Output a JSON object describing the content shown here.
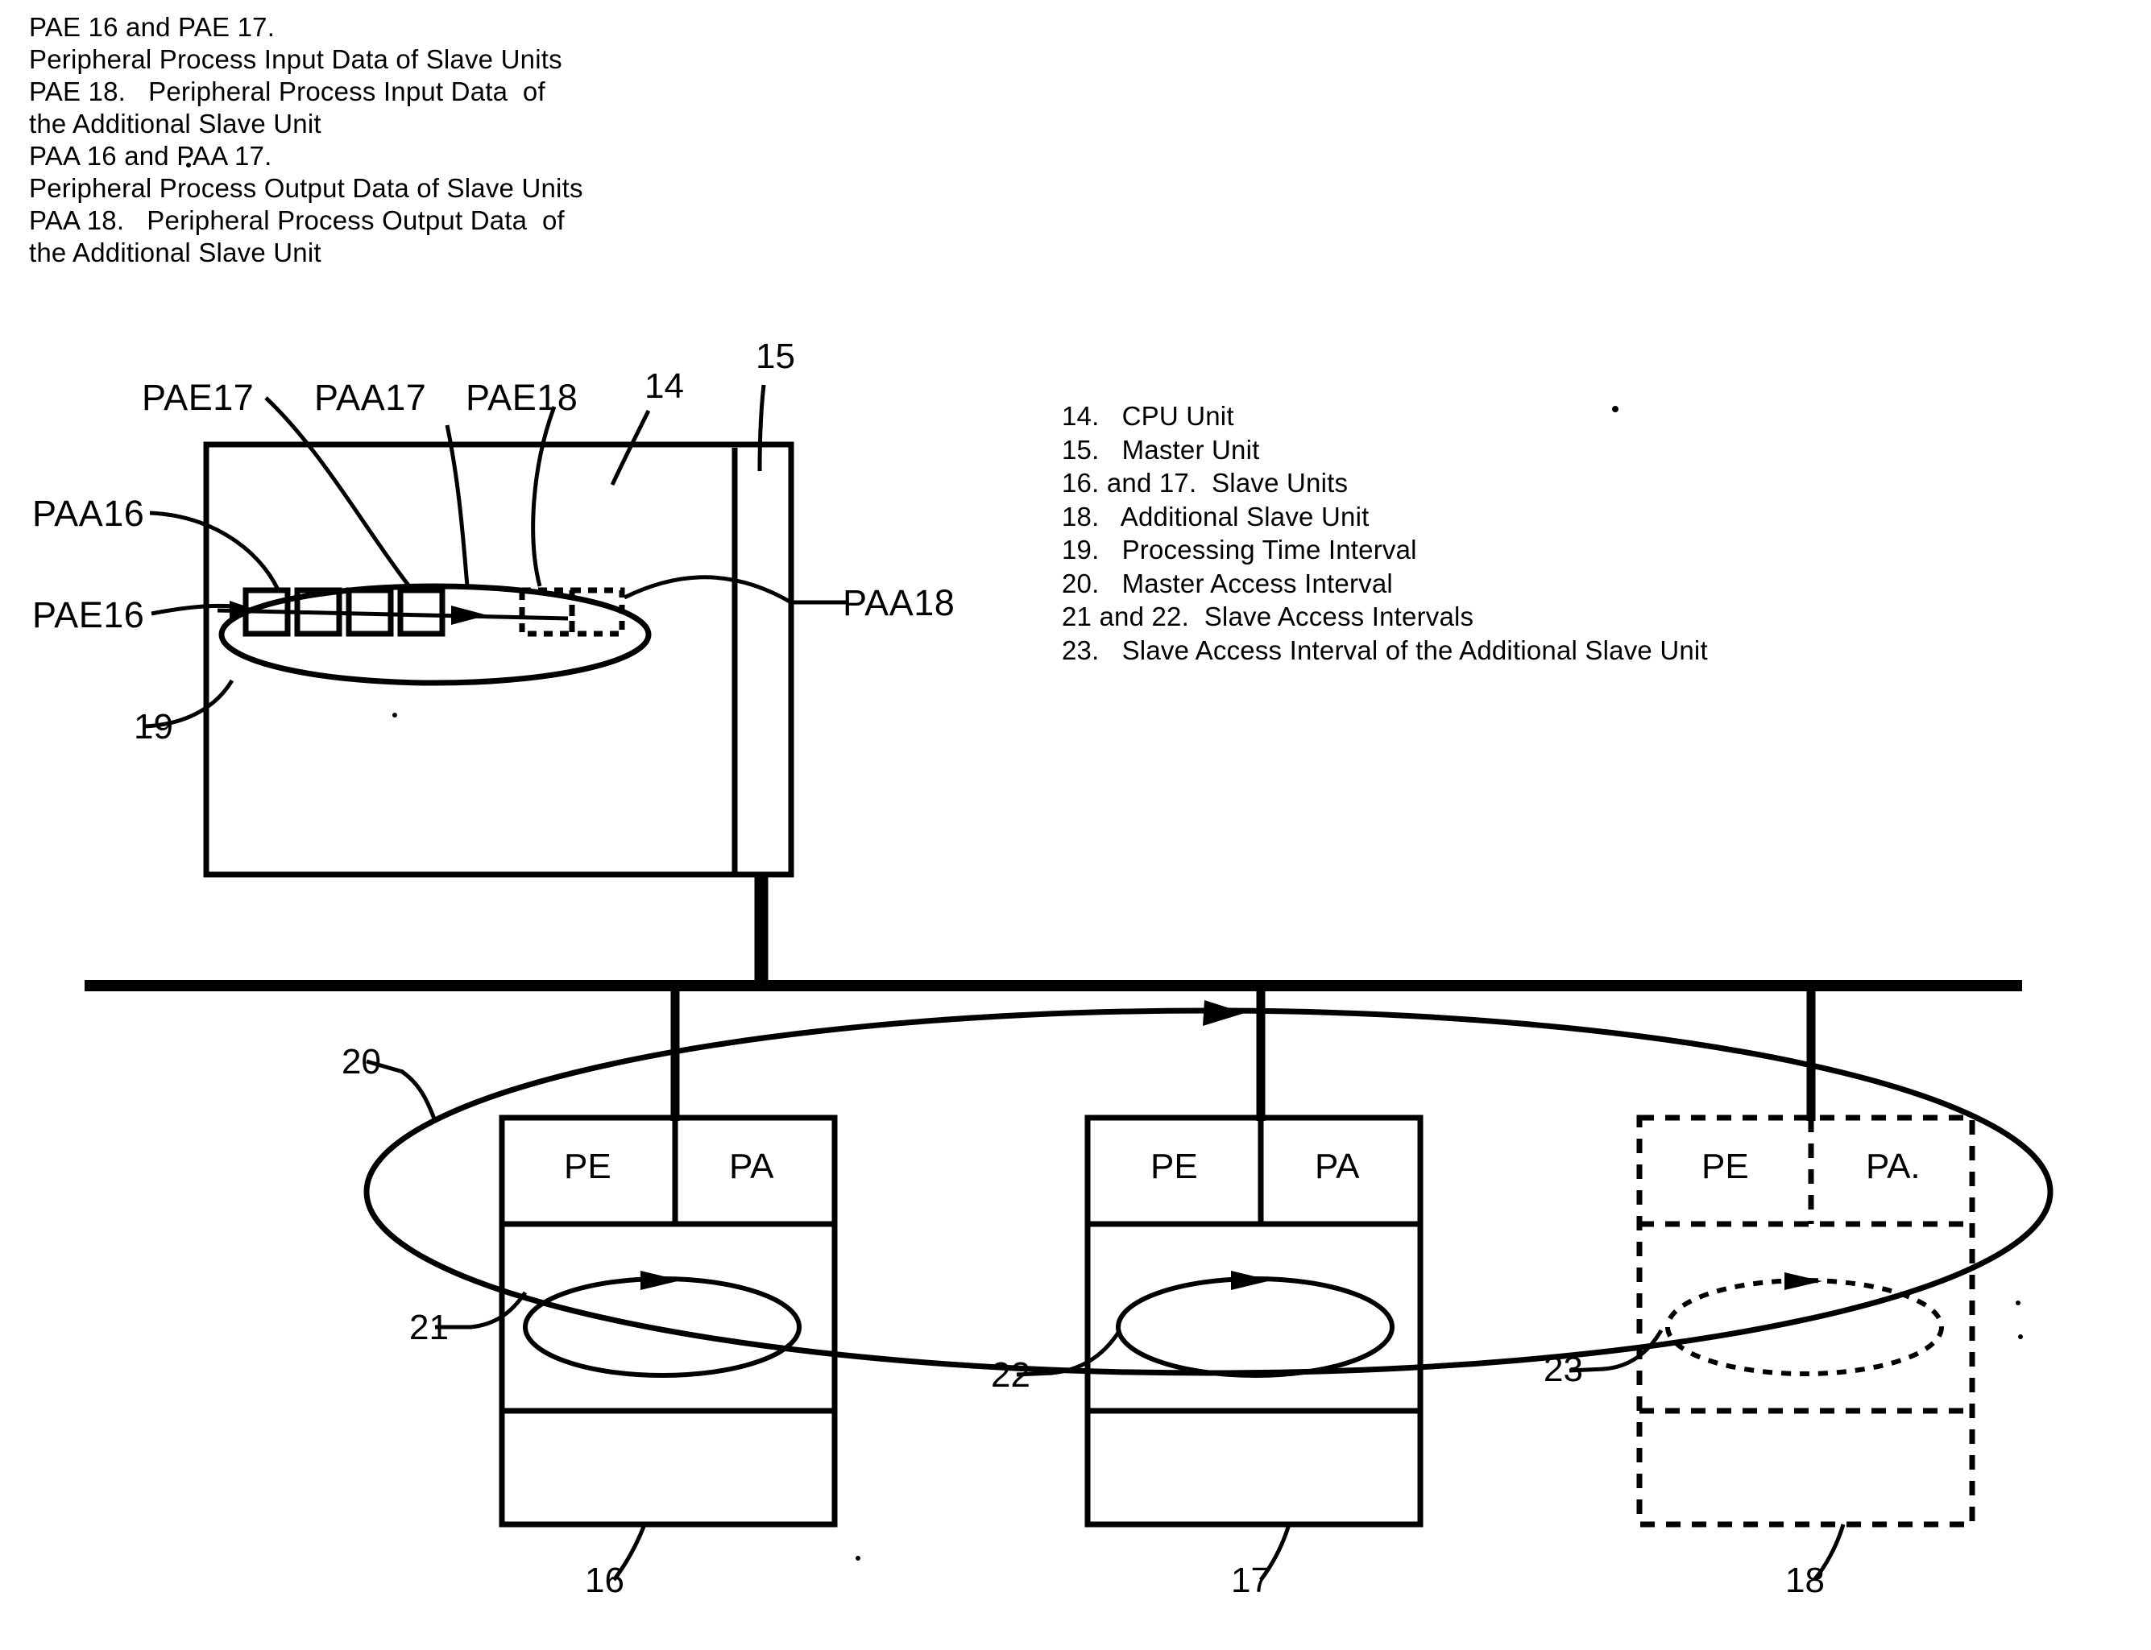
{
  "header_note": {
    "lines": [
      "PAE 16 and PAE 17.",
      "Peripheral Process Input Data of Slave Units",
      "PAE 18.   Peripheral Process Input Data  of",
      "the Additional Slave Unit",
      "PAA 16 and PAA 17.",
      "Peripheral Process Output Data of Slave Units",
      "PAA 18.   Peripheral Process Output Data  of",
      "the Additional Slave Unit"
    ]
  },
  "legend": {
    "lines": [
      "14.   CPU Unit",
      "15.   Master Unit",
      "16. and 17.  Slave Units",
      "18.   Additional Slave Unit",
      "19.   Processing Time Interval",
      "20.   Master Access Interval",
      "21 and 22.  Slave Access Intervals",
      "23.   Slave Access Interval of the Additional Slave Unit"
    ]
  },
  "diagram": {
    "cpu_unit": {
      "ref": "14",
      "master_ref": "15",
      "cell_labels": {
        "pae16": "PAE16",
        "paa16": "PAA16",
        "pae17": "PAE17",
        "paa17": "PAA17",
        "pae18": "PAE18",
        "paa18": "PAA18"
      },
      "interval_ref": "19"
    },
    "bus": {
      "master_access_interval_ref": "20"
    },
    "slaves": [
      {
        "ref": "16",
        "pe": "PE",
        "pa": "PA",
        "interval_ref": "21",
        "style": "solid"
      },
      {
        "ref": "17",
        "pe": "PE",
        "pa": "PA",
        "interval_ref": "22",
        "style": "solid"
      },
      {
        "ref": "18",
        "pe": "PE",
        "pa": "PA.",
        "interval_ref": "23",
        "style": "dashed"
      }
    ]
  },
  "colors": {
    "ink": "#000000",
    "paper": "#ffffff"
  }
}
